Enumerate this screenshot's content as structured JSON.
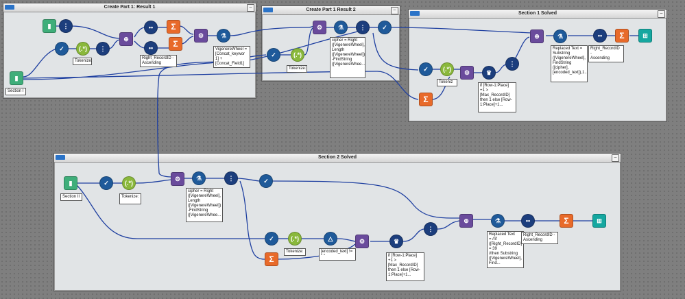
{
  "containers": {
    "c1": {
      "title": "Create Part 1: Result 1"
    },
    "c2": {
      "title": "Create Part 1 Result 2"
    },
    "c3": {
      "title": "Section 1 Solved"
    },
    "c4": {
      "title": "Section 2 Solved"
    }
  },
  "labels": {
    "section1": "Section I",
    "tokenize1": "Tokenize:",
    "right_rec1": "Right_RecordID -\nAscending",
    "vigenere": "VigenereWheel =\n[Concat_keywor\n1] +\n[Concat_Field1]",
    "tokenize2": "Tokenize:",
    "cipher1": "cipher = Right\n([VigenereWheel],\nLength\n([VigenereWheel])\n-FindString\n([VigenereWhee...",
    "tokenize3": "Tokeniz",
    "ifrow1": "if [Row-1:Place]\n+1 >\n[Max_RecordID]\nthen 1 else [Row-\n1:Place]+1...",
    "replaced1": "Replaced Text =\nSubstring\n([VigenereWheel],\nFindString\n([cipher],\n[encoded_text]),1...",
    "right_rec2": "Right_RecordID -\nAscending",
    "section2": "Section II",
    "tokenize4": "Tokenize:",
    "cipher2": "cipher = Right\n([VigenereWheel],\nLength\n([VigenereWheel])\n-FindString\n([VigenereWhee...",
    "tokenize5": "Tokenize:",
    "encoded": "[encoded_text] !=\n\" \"",
    "ifrow2": "if [Row-1:Place]\n+1 >\n[Max_RecordID]\nthen 1 else [Row-\n1:Place]+1...",
    "replaced2": "Replaced Text\n= //if\n([Right_RecordID]\n= 39\n//then Substring\n([VigenereWheel],\nFind...",
    "right_rec3": "Right_RecordID -\nAscending"
  },
  "icons": {
    "book": "book-icon",
    "select": "select-icon",
    "check": "check-icon",
    "regex": "regex-icon",
    "join": "join-icon",
    "sum": "summarize-icon",
    "formula": "formula-icon",
    "multirow": "multi-row-icon",
    "sort": "sort-icon",
    "browse": "browse-icon",
    "filter": "filter-icon",
    "append": "append-icon"
  }
}
